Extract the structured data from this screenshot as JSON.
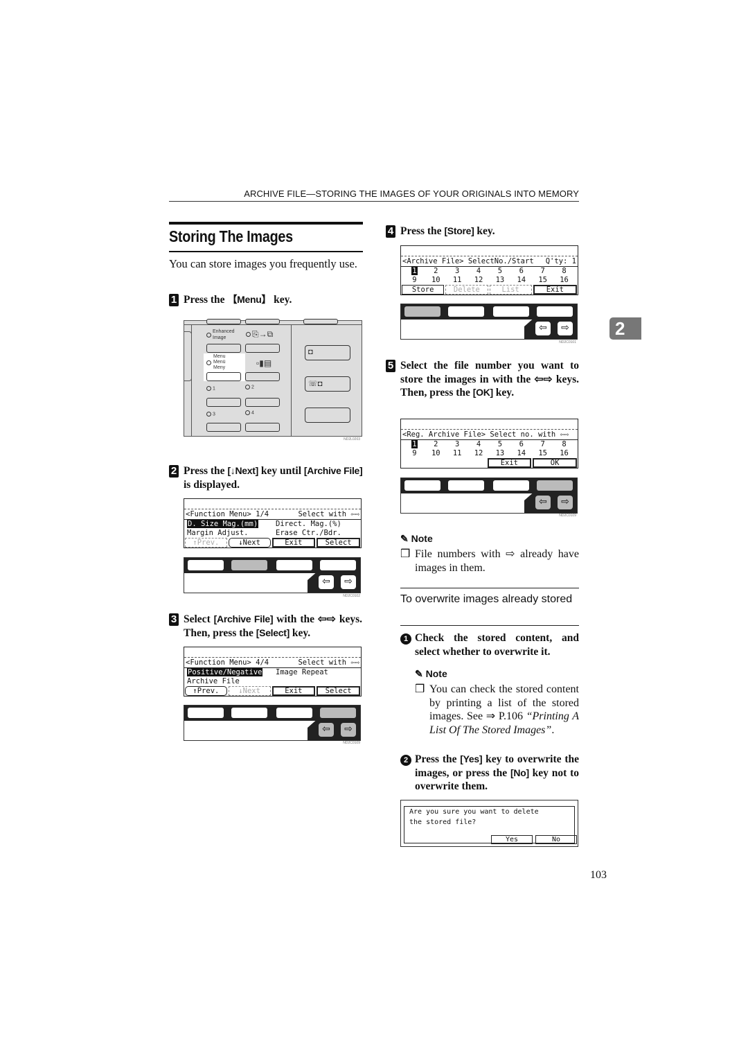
{
  "header": {
    "running_title": "ARCHIVE FILE—STORING THE IMAGES OF YOUR ORIGINALS INTO MEMORY"
  },
  "section": {
    "title": "Storing The Images",
    "intro": "You can store images you frequently use."
  },
  "chapter_tab": "2",
  "page_number": "103",
  "steps": [
    {
      "num": "1",
      "text_before": "Press the ",
      "key": "【Menu】",
      "text_after": " key.",
      "figure": {
        "code": "ND2L0203",
        "control_panel": {
          "enhanced_image_label": "Enhanced Image",
          "menu_label_lines": [
            "Menu",
            "Menü",
            "Meny"
          ],
          "number_labels": [
            "1",
            "2",
            "3",
            "4"
          ],
          "icons": [
            "duplex-copy-icon",
            "signal-strength-icon",
            "copy-mode-icon",
            "fax-mode-icon"
          ]
        }
      }
    },
    {
      "num": "2",
      "text_before": "Press the ",
      "key": "[↓Next]",
      "text_mid": " key until ",
      "key2": "[Archive File]",
      "text_after": " is displayed.",
      "figure": {
        "code": "ND2C0102",
        "lcd": {
          "title_left": "<Function Menu> 1/4",
          "title_right": "Select with ⇦⇨",
          "items": [
            [
              "D. Size Mag.(mm)",
              "Direct. Mag.(%)"
            ],
            [
              "Margin Adjust.",
              "Erase Ctr./Bdr."
            ]
          ],
          "selected_item": "D. Size Mag.(mm)",
          "buttons": [
            "↑Prev.",
            "↓Next",
            "Exit",
            "Select"
          ],
          "disabled_buttons": [
            "↑Prev."
          ]
        }
      }
    },
    {
      "num": "3",
      "text_before": "Select ",
      "key": "[Archive File]",
      "text_mid": " with the ⇦⇨ keys. Then, press the ",
      "key2": "[Select]",
      "text_after": " key.",
      "figure": {
        "code": "ND2C0109",
        "lcd": {
          "title_left": "<Function Menu> 4/4",
          "title_right": "Select with ⇦⇨",
          "items": [
            [
              "Positive/Negative",
              "Image Repeat"
            ],
            [
              "Archive File",
              ""
            ]
          ],
          "selected_item": "Positive/Negative",
          "buttons": [
            "↑Prev.",
            "↓Next",
            "Exit",
            "Select"
          ],
          "disabled_buttons": [
            "↓Next"
          ]
        }
      }
    },
    {
      "num": "4",
      "text_before": "Press the ",
      "key": "[Store]",
      "text_after": " key.",
      "figure": {
        "code": "ND2C0101",
        "lcd": {
          "title_left": "<Archive File> SelectNo./Start",
          "title_right": "Q'ty: 1",
          "numbers_row1": [
            "1",
            "2",
            "3",
            "4",
            "5",
            "6",
            "7",
            "8"
          ],
          "numbers_row2": [
            "9",
            "10",
            "11",
            "12",
            "13",
            "14",
            "15",
            "16"
          ],
          "selected_number": "1",
          "buttons": [
            "Store",
            "Delete",
            "List",
            "Exit"
          ],
          "disabled_buttons": [
            "Delete",
            "List"
          ]
        }
      }
    },
    {
      "num": "5",
      "text_before": "Select the file number you want to store the images in with the ⇦⇨ keys. Then, press the ",
      "key": "[OK]",
      "text_after": " key.",
      "figure": {
        "code": "ND2C0109",
        "lcd": {
          "title_left": "<Reg. Archive File> Select no. with ⇦⇨",
          "title_right": "",
          "numbers_row1": [
            "1",
            "2",
            "3",
            "4",
            "5",
            "6",
            "7",
            "8"
          ],
          "numbers_row2": [
            "9",
            "10",
            "11",
            "12",
            "13",
            "14",
            "15",
            "16"
          ],
          "selected_number": "1",
          "buttons": [
            "",
            "",
            "Exit",
            "OK"
          ]
        }
      }
    }
  ],
  "note1": {
    "heading": "Note",
    "text_before": "File numbers with ",
    "icon": "stored-file-arrow-icon",
    "text_after": " already have images in them."
  },
  "subsection": {
    "title": "To overwrite images already stored",
    "substeps": [
      {
        "num": "1",
        "text": "Check the stored content, and select whether to overwrite it."
      },
      {
        "num": "2",
        "text_before": "Press the ",
        "key": "[Yes]",
        "text_mid": " key to overwrite the images, or press the ",
        "key2": "[No]",
        "text_after": " key not to overwrite them."
      }
    ],
    "note": {
      "heading": "Note",
      "text": "You can check the stored content by printing a list of the stored images. See ⇒ P.106 ",
      "link": "“Printing A List Of The Stored Images”",
      "text_after": "."
    },
    "dialog": {
      "line1": "Are you sure you want to delete",
      "line2": "the stored file?",
      "buttons": [
        "Yes",
        "No"
      ]
    }
  }
}
